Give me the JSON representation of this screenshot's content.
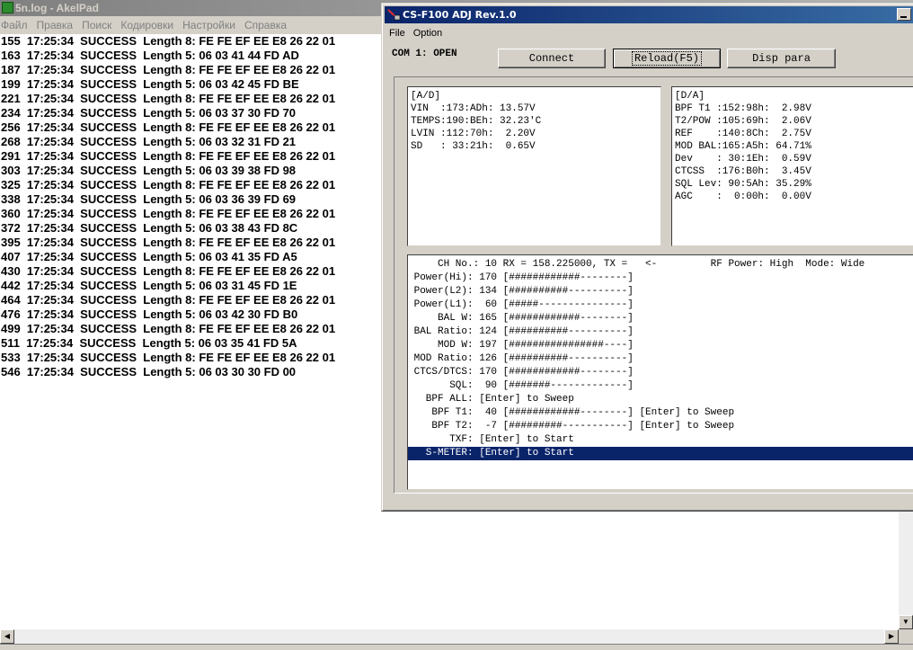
{
  "akelpad": {
    "title": "5n.log - AkelPad",
    "menu": [
      "Файл",
      "Правка",
      "Поиск",
      "Кодировки",
      "Настройки",
      "Справка"
    ],
    "lines": [
      "155  17:25:34  SUCCESS  Length 8: FE FE EF EE E8 26 22 01",
      "163  17:25:34  SUCCESS  Length 5: 06 03 41 44 FD AD",
      "187  17:25:34  SUCCESS  Length 8: FE FE EF EE E8 26 22 01",
      "199  17:25:34  SUCCESS  Length 5: 06 03 42 45 FD BE",
      "221  17:25:34  SUCCESS  Length 8: FE FE EF EE E8 26 22 01",
      "234  17:25:34  SUCCESS  Length 5: 06 03 37 30 FD 70",
      "256  17:25:34  SUCCESS  Length 8: FE FE EF EE E8 26 22 01",
      "268  17:25:34  SUCCESS  Length 5: 06 03 32 31 FD 21",
      "291  17:25:34  SUCCESS  Length 8: FE FE EF EE E8 26 22 01",
      "303  17:25:34  SUCCESS  Length 5: 06 03 39 38 FD 98",
      "325  17:25:34  SUCCESS  Length 8: FE FE EF EE E8 26 22 01",
      "338  17:25:34  SUCCESS  Length 5: 06 03 36 39 FD 69",
      "360  17:25:34  SUCCESS  Length 8: FE FE EF EE E8 26 22 01",
      "372  17:25:34  SUCCESS  Length 5: 06 03 38 43 FD 8C",
      "395  17:25:34  SUCCESS  Length 8: FE FE EF EE E8 26 22 01",
      "407  17:25:34  SUCCESS  Length 5: 06 03 41 35 FD A5",
      "430  17:25:34  SUCCESS  Length 8: FE FE EF EE E8 26 22 01",
      "442  17:25:34  SUCCESS  Length 5: 06 03 31 45 FD 1E",
      "464  17:25:34  SUCCESS  Length 8: FE FE EF EE E8 26 22 01",
      "476  17:25:34  SUCCESS  Length 5: 06 03 42 30 FD B0",
      "499  17:25:34  SUCCESS  Length 8: FE FE EF EE E8 26 22 01",
      "511  17:25:34  SUCCESS  Length 5: 06 03 35 41 FD 5A",
      "533  17:25:34  SUCCESS  Length 8: FE FE EF EE E8 26 22 01",
      "546  17:25:34  SUCCESS  Length 5: 06 03 30 30 FD 00"
    ]
  },
  "csf100": {
    "title": "CS-F100 ADJ Rev.1.0",
    "menu": [
      "File",
      "Option"
    ],
    "com_status": "COM 1: OPEN",
    "buttons": {
      "connect": "Connect",
      "reload": "Reload(F5)",
      "disp": "Disp para"
    },
    "ad_panel": [
      "[A/D]",
      "VIN  :173:ADh: 13.57V",
      "TEMPS:190:BEh: 32.23'C",
      "LVIN :112:70h:  2.20V",
      "SD   : 33:21h:  0.65V"
    ],
    "da_panel": [
      "[D/A]",
      "BPF T1 :152:98h:  2.98V",
      "T2/POW :105:69h:  2.06V",
      "REF    :140:8Ch:  2.75V",
      "MOD BAL:165:A5h: 64.71%",
      "Dev    : 30:1Eh:  0.59V",
      "CTCSS  :176:B0h:  3.45V",
      "SQL Lev: 90:5Ah: 35.29%",
      "AGC    :  0:00h:  0.00V"
    ],
    "ch_lines": [
      "     CH No.: 10 RX = 158.225000, TX =   <-         RF Power: High  Mode: Wide",
      " Power(Hi): 170 [############--------]",
      " Power(L2): 134 [##########----------]",
      " Power(L1):  60 [#####---------------]",
      "     BAL W: 165 [############--------]",
      " BAL Ratio: 124 [##########----------]",
      "     MOD W: 197 [################----]",
      " MOD Ratio: 126 [##########----------]",
      " CTCS/DTCS: 170 [############--------]",
      "       SQL:  90 [#######-------------]",
      "   BPF ALL: [Enter] to Sweep",
      "    BPF T1:  40 [############--------] [Enter] to Sweep",
      "    BPF T2:  -7 [#########-----------] [Enter] to Sweep",
      "       TXF: [Enter] to Start",
      "   S-METER: [Enter] to Start"
    ]
  }
}
